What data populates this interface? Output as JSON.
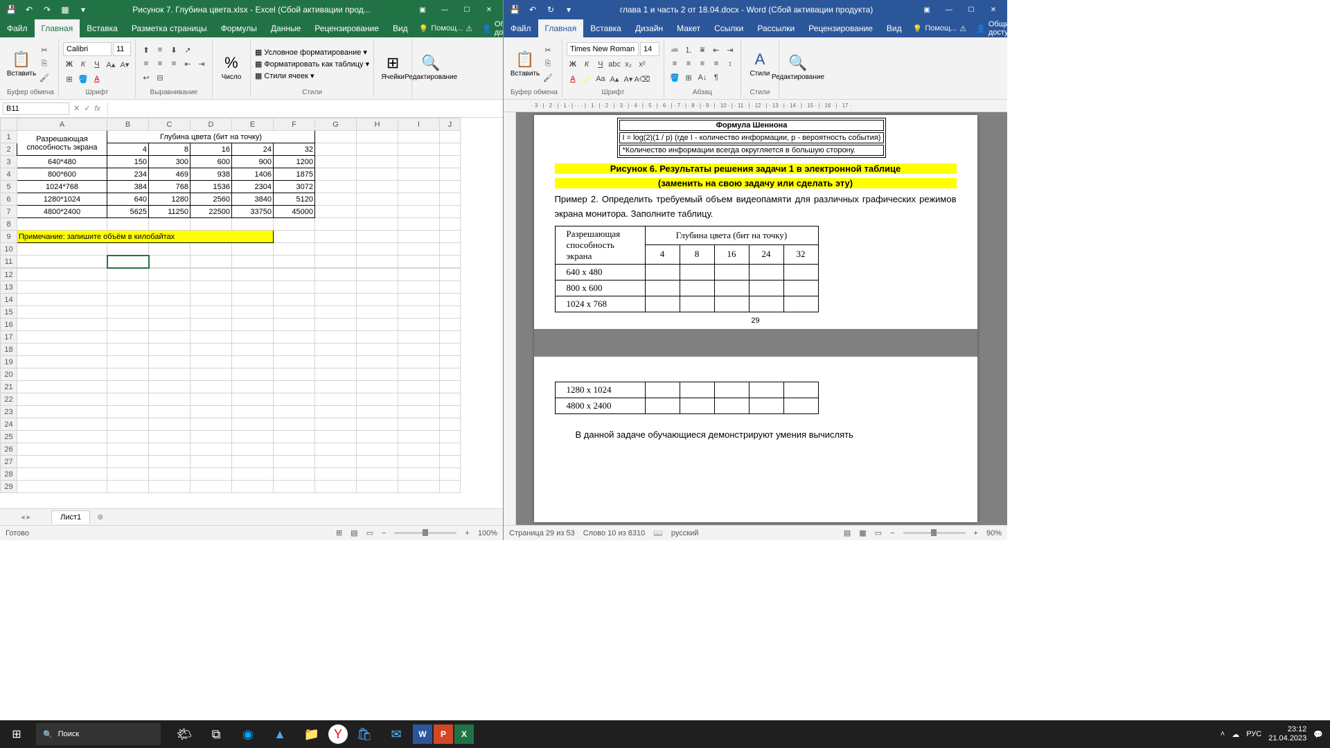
{
  "excel": {
    "title": "Рисунок 7. Глубина цвета.xlsx - Excel (Сбой активации прод...",
    "tabs": [
      "Файл",
      "Главная",
      "Вставка",
      "Разметка страницы",
      "Формулы",
      "Данные",
      "Рецензирование",
      "Вид"
    ],
    "active_tab": "Главная",
    "tell_me": "Помощ...",
    "share": "Общий доступ",
    "ribbon": {
      "clipboard": "Буфер обмена",
      "paste": "Вставить",
      "font": "Шрифт",
      "font_name": "Calibri",
      "font_size": "11",
      "alignment": "Выравнивание",
      "number": "Число",
      "styles": "Стили",
      "cond_format": "Условное форматирование",
      "as_table": "Форматировать как таблицу",
      "cell_styles": "Стили ячеек",
      "cells": "Ячейки",
      "editing": "Редактирование"
    },
    "name_box": "B11",
    "columns": [
      "A",
      "B",
      "C",
      "D",
      "E",
      "F",
      "G",
      "H",
      "I",
      "J"
    ],
    "data_rows": [
      {
        "n": "1",
        "A": "Разрешающая",
        "merge": "Глубина цвета (бит на точку)"
      },
      {
        "n": "2",
        "A": "способность экрана",
        "B": "4",
        "C": "8",
        "D": "16",
        "E": "24",
        "F": "32"
      },
      {
        "n": "3",
        "A": "640*480",
        "B": "150",
        "C": "300",
        "D": "600",
        "E": "900",
        "F": "1200"
      },
      {
        "n": "4",
        "A": "800*600",
        "B": "234",
        "C": "469",
        "D": "938",
        "E": "1406",
        "F": "1875"
      },
      {
        "n": "5",
        "A": "1024*768",
        "B": "384",
        "C": "768",
        "D": "1536",
        "E": "2304",
        "F": "3072"
      },
      {
        "n": "6",
        "A": "1280*1024",
        "B": "640",
        "C": "1280",
        "D": "2560",
        "E": "3840",
        "F": "5120"
      },
      {
        "n": "7",
        "A": "4800*2400",
        "B": "5625",
        "C": "11250",
        "D": "22500",
        "E": "33750",
        "F": "45000"
      }
    ],
    "note_row": {
      "n": "9",
      "text": "Примечание: запишите объём в килобайтах"
    },
    "sheet_tab": "Лист1",
    "status": "Готово",
    "zoom": "100%"
  },
  "word": {
    "title": "глава 1 и часть 2 от 18.04.docx - Word (Сбой активации продукта)",
    "tabs": [
      "Файл",
      "Главная",
      "Вставка",
      "Дизайн",
      "Макет",
      "Ссылки",
      "Рассылки",
      "Рецензирование",
      "Вид"
    ],
    "active_tab": "Главная",
    "tell_me": "Помощ...",
    "share": "Общий доступ",
    "ribbon": {
      "clipboard": "Буфер обмена",
      "paste": "Вставить",
      "font": "Шрифт",
      "font_name": "Times New Roman",
      "font_size": "14",
      "paragraph": "Абзац",
      "styles": "Стили",
      "editing": "Редактирование"
    },
    "doc": {
      "shannon_title": "Формула Шеннона",
      "shannon_f": "I = log(2)(1 / p) (где I - количество информации, p - вероятность события)",
      "shannon_note": "*Количество информации всегда округляется в большую сторону.",
      "caption1": "Рисунок 6. Результаты решения задачи 1 в электронной таблице",
      "caption2": "(заменить на свою задачу или сделать эту)",
      "para": "Пример 2. Определить требуемый объем видеопамяти для различных графических режимов экрана монитора. Заполните таблицу.",
      "table_head": "Разрешающая способность экрана",
      "table_head2": "Глубина цвета (бит на точку)",
      "cols": [
        "4",
        "8",
        "16",
        "24",
        "32"
      ],
      "rows1": [
        "640 x 480",
        "800 x 600",
        "1024 x 768"
      ],
      "page_num": "29",
      "rows2": [
        "1280 x 1024",
        "4800 x 2400"
      ],
      "tail": "В данной задаче обучающиеся демонстрируют умения вычислять"
    },
    "status_page": "Страница 29 из 53",
    "status_words": "Слово 10 из 8310",
    "status_lang": "русский",
    "zoom": "90%"
  },
  "taskbar": {
    "search": "Поиск",
    "lang": "РУС",
    "time": "23:12",
    "date": "21.04.2023"
  }
}
